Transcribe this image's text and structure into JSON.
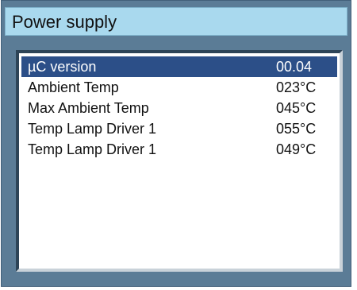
{
  "window": {
    "title": "Power supply"
  },
  "list": {
    "items": [
      {
        "label": "µC version",
        "value": "00.04",
        "selected": true
      },
      {
        "label": "Ambient Temp",
        "value": "023°C",
        "selected": false
      },
      {
        "label": "Max Ambient Temp",
        "value": "045°C",
        "selected": false
      },
      {
        "label": "Temp Lamp Driver 1",
        "value": "055°C",
        "selected": false
      },
      {
        "label": "Temp Lamp Driver 1",
        "value": "049°C",
        "selected": false
      }
    ]
  },
  "colors": {
    "frame": "#5b7c96",
    "title_bar": "#a9d9ee",
    "selection": "#2c4f88",
    "panel": "#ffffff"
  }
}
